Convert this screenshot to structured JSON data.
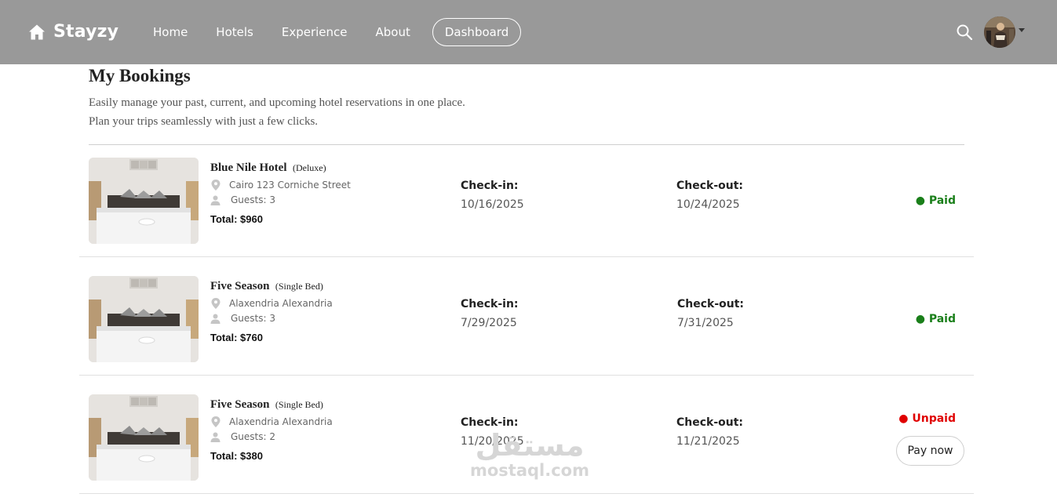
{
  "navbar": {
    "brand": "Stayzy",
    "links": [
      "Home",
      "Hotels",
      "Experience",
      "About"
    ],
    "dashboard_label": "Dashboard",
    "icons": {
      "home": "home-icon",
      "search": "search-icon",
      "avatar": "user-avatar",
      "caret": "caret-down-icon"
    }
  },
  "page": {
    "title": "My Bookings",
    "intro_line1": "Easily manage your past, current, and upcoming hotel reservations in one place.",
    "intro_line2": "Plan your trips seamlessly with just a few clicks."
  },
  "bookings": [
    {
      "hotel": "Blue Nile Hotel",
      "room_type": "(Deluxe)",
      "location": "Cairo 123 Corniche Street",
      "guests": "Guests: 3",
      "total": "Total: $960",
      "checkin_label": "Check-in:",
      "checkin": "10/16/2025",
      "checkout_label": "Check-out:",
      "checkout": "10/24/2025",
      "status": "● Paid"
    },
    {
      "hotel": "Five Season",
      "room_type": "(Single Bed)",
      "location": "Alaxendria Alexandria",
      "guests": "Guests: 3",
      "total": "Total: $760",
      "checkin_label": "Check-in:",
      "checkin": "7/29/2025",
      "checkout_label": "Check-out:",
      "checkout": "7/31/2025",
      "status": "● Paid"
    },
    {
      "hotel": "Five Season",
      "room_type": "(Single Bed)",
      "location": "Alaxendria Alexandria",
      "guests": "Guests: 2",
      "total": "Total: $380",
      "checkin_label": "Check-in:",
      "checkin": "11/20/2025",
      "checkout_label": "Check-out:",
      "checkout": "11/21/2025",
      "status": "● Unpaid",
      "action": "Pay now"
    }
  ],
  "watermark": {
    "arabic": "مستقل",
    "latin": "mostaql.com"
  },
  "colors": {
    "navbar": "#999999",
    "paid": "#1a7f1a",
    "unpaid": "#e00000",
    "divider": "#e0e0e0"
  }
}
